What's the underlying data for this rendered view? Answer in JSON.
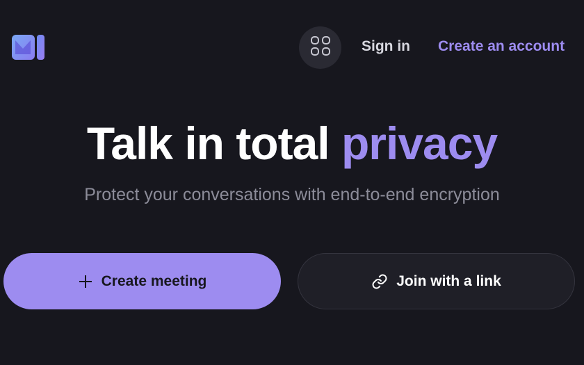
{
  "header": {
    "logo_icon": "video-logo-icon",
    "apps_icon": "apps-grid-icon",
    "signin_label": "Sign in",
    "create_account_label": "Create an account"
  },
  "hero": {
    "title_main": "Talk in total ",
    "title_accent": "privacy",
    "subtitle": "Protect your conversations with end-to-end encryption"
  },
  "actions": {
    "create_label": "Create meeting",
    "create_icon": "plus-icon",
    "join_label": "Join with a link",
    "join_icon": "link-icon"
  },
  "colors": {
    "background": "#17171e",
    "accent": "#9d8cf0",
    "text": "#ffffff",
    "muted": "#8c8c99"
  }
}
